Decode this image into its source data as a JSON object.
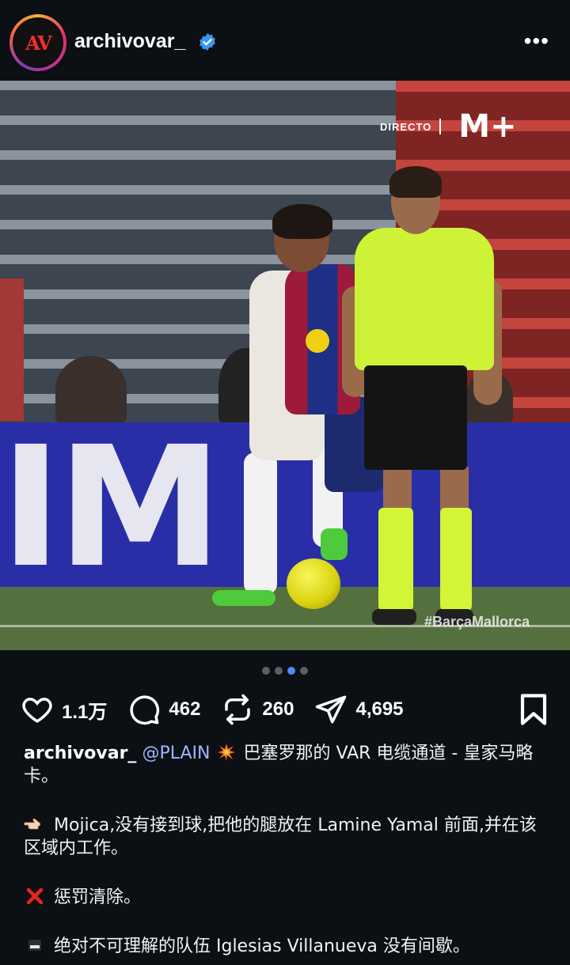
{
  "header": {
    "username": "archivovar_",
    "avatar_text": "AV",
    "more_label": "•••"
  },
  "media": {
    "broadcast_label": "DIRECTO",
    "channel_logo": "M+",
    "banner_text": "IM",
    "hashtag": "#BarçaMallorca",
    "carousel_total": 4,
    "carousel_active": 3
  },
  "actions": {
    "likes": "1.1万",
    "comments": "462",
    "reposts": "260",
    "shares": "4,695"
  },
  "caption": {
    "username": "archivovar_",
    "mention": "@PLAIN",
    "line1_emoji": "collision-icon",
    "line1_text": " 巴塞罗那的 VAR 电缆通道 - 皇家马略卡。",
    "line2_emoji": "pointing-hand-icon",
    "line2_text": "Mojica,没有接到球,把他的腿放在 Lamine Yamal 前面,并在该区域内工作。",
    "line3_emoji": "cross-mark-icon",
    "line3_text": "惩罚清除。",
    "line4_emoji": "black-square-icon",
    "line4_text": "绝对不可理解的队伍 Iglesias Villanueva 没有间歇。"
  },
  "colors": {
    "background": "#0c0f14",
    "accent_dot": "#4e8cf7",
    "mention": "#9ab8ff",
    "verified": "#3897f0"
  }
}
